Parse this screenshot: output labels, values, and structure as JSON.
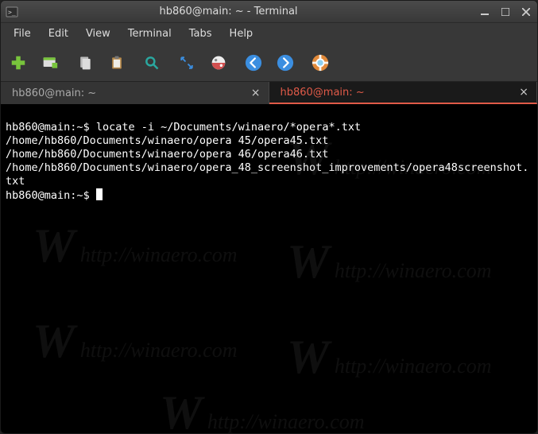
{
  "titlebar": {
    "title": "hb860@main: ~ - Terminal"
  },
  "menu": {
    "file": "File",
    "edit": "Edit",
    "view": "View",
    "terminal": "Terminal",
    "tabs": "Tabs",
    "help": "Help"
  },
  "toolbar_icons": {
    "new_tab": "new-tab-icon",
    "new_window": "new-window-icon",
    "copy": "copy-icon",
    "paste": "paste-icon",
    "search": "search-icon",
    "fullscreen": "fullscreen-icon",
    "preferences": "preferences-icon",
    "back": "back-arrow-icon",
    "forward": "forward-arrow-icon",
    "help": "help-buoy-icon"
  },
  "tabs": [
    {
      "label": "hb860@main: ~",
      "active": false
    },
    {
      "label": "hb860@main: ~",
      "active": true
    }
  ],
  "terminal": {
    "prompt_user": "hb860@main",
    "prompt_path": "~",
    "prompt_suffix": "$",
    "command": "locate -i ~/Documents/winaero/*opera*.txt",
    "output": [
      "/home/hb860/Documents/winaero/opera 45/opera45.txt",
      "/home/hb860/Documents/winaero/opera 46/opera46.txt",
      "/home/hb860/Documents/winaero/opera_48_screenshot_improvements/opera48screenshot.txt"
    ]
  },
  "colors": {
    "accent_tab": "#e05a48",
    "toolbar_green": "#78c43c",
    "toolbar_teal": "#2aa79f",
    "toolbar_blue": "#3b8ee0"
  },
  "watermark_text": "http://winaero.com"
}
